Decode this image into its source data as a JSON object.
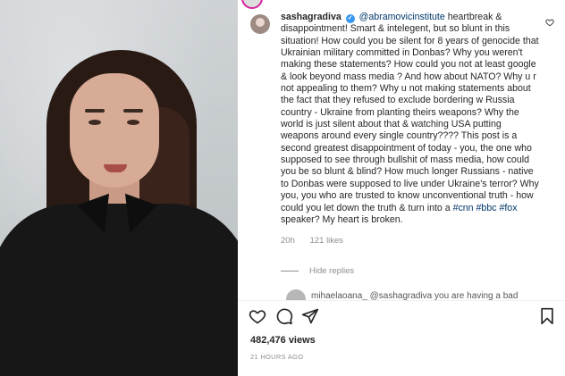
{
  "comment": {
    "username": "sashagradiva",
    "verified_icon": "check-icon",
    "mention": "@abramovicinstitute",
    "text_before_hashtags": "heartbreak & disappointment! Smart & intelegent, but so blunt in this situation! How could you be silent for 8 years of genocide that Ukrainian military committed in Donbas? Why you weren't making these statements? How could you not at least google & look beyond mass media ? And how about NATO? Why u r not appealing to them? Why u not making statements about the fact that they refused to exclude bordering w Russia country - Ukraine from planting theirs weapons? Why the world is just silent about that & watching USA putting weapons around every single country???? This post is a second greatest disappointment of today - you, the one who supposed to see through bullshit of mass media, how could you be so blunt & blind? How much longer Russians - native to Donbas were supposed to live under Ukraine's terror? Why you, you who are trusted to know unconventional truth - how could you let down the truth & turn into a",
    "hashtags": [
      "#cnn",
      "#bbc",
      "#fox"
    ],
    "text_after_hashtags": "speaker? My heart is broken.",
    "age": "20h",
    "likes": "121 likes",
    "hide_replies": "Hide replies",
    "reply_preview": "mihaelaoana_ @sashagradiva you are having a bad"
  },
  "post": {
    "views": "482,476 views",
    "timestamp": "21 HOURS AGO"
  },
  "icons": {
    "like": "heart-icon",
    "comment": "comment-icon",
    "share": "send-icon",
    "save": "bookmark-icon",
    "comment_like": "heart-icon"
  },
  "colors": {
    "link": "#00376b",
    "verified": "#3897f0",
    "muted": "#8e8e8e",
    "text": "#262626"
  }
}
